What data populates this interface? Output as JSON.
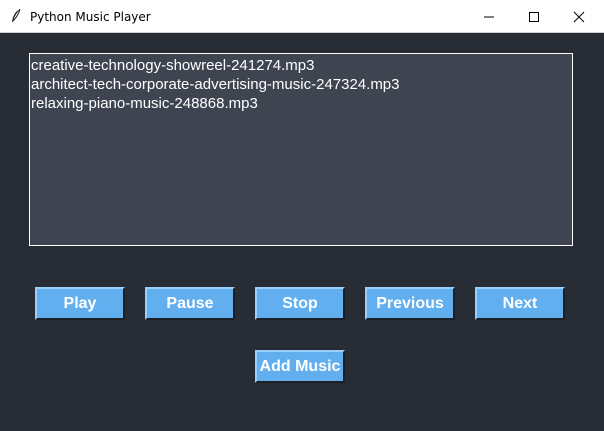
{
  "window": {
    "title": "Python Music Player"
  },
  "playlist": {
    "items": [
      "creative-technology-showreel-241274.mp3",
      "architect-tech-corporate-advertising-music-247324.mp3",
      "relaxing-piano-music-248868.mp3"
    ]
  },
  "controls": {
    "play": "Play",
    "pause": "Pause",
    "stop": "Stop",
    "previous": "Previous",
    "next": "Next",
    "add_music": "Add Music"
  },
  "colors": {
    "background": "#282c34",
    "listbox": "#3f4451",
    "button": "#61afef",
    "text": "#ffffff"
  },
  "icons": {
    "app": "feather-icon",
    "minimize": "minimize-icon",
    "maximize": "maximize-icon",
    "close": "close-icon"
  }
}
